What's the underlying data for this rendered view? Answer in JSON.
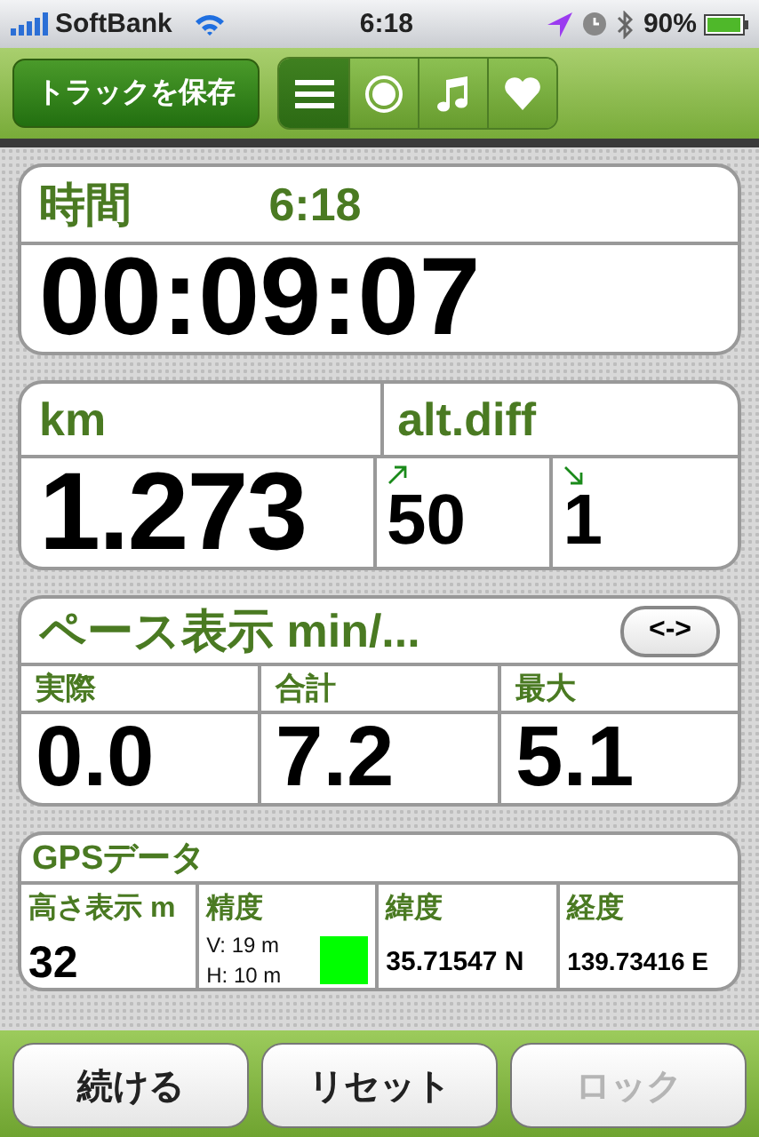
{
  "status_bar": {
    "carrier": "SoftBank",
    "time": "6:18",
    "battery": "90%"
  },
  "toolbar": {
    "save_button": "トラックを保存",
    "segments": [
      {
        "kind": "list",
        "selected": true
      },
      {
        "kind": "record",
        "selected": false
      },
      {
        "kind": "music",
        "selected": false
      },
      {
        "kind": "heart",
        "selected": false
      }
    ]
  },
  "time_panel": {
    "label": "時間",
    "clock": "6:18",
    "elapsed": "00:09:07"
  },
  "distance_panel": {
    "label": "km",
    "value": "1.273",
    "alt_label": "alt.diff",
    "ascent": "50",
    "descent": "1"
  },
  "pace_panel": {
    "label": "ペース表示 min/...",
    "toggle": "<->",
    "columns": [
      {
        "label": "実際",
        "value": "0.0"
      },
      {
        "label": "合計",
        "value": "7.2"
      },
      {
        "label": "最大",
        "value": "5.1"
      }
    ]
  },
  "gps_panel": {
    "label": "GPSデータ",
    "altitude": {
      "label": "高さ表示 m",
      "value": "32"
    },
    "accuracy": {
      "label": "精度",
      "vertical": "V: 19 m",
      "horizontal": "H: 10 m",
      "color": "#00ff00"
    },
    "latitude": {
      "label": "緯度",
      "value": "35.71547 N"
    },
    "longitude": {
      "label": "経度",
      "value": "139.73416 E"
    }
  },
  "buttons": [
    {
      "label": "続ける",
      "disabled": false
    },
    {
      "label": "リセット",
      "disabled": false
    },
    {
      "label": "ロック",
      "disabled": true
    }
  ]
}
